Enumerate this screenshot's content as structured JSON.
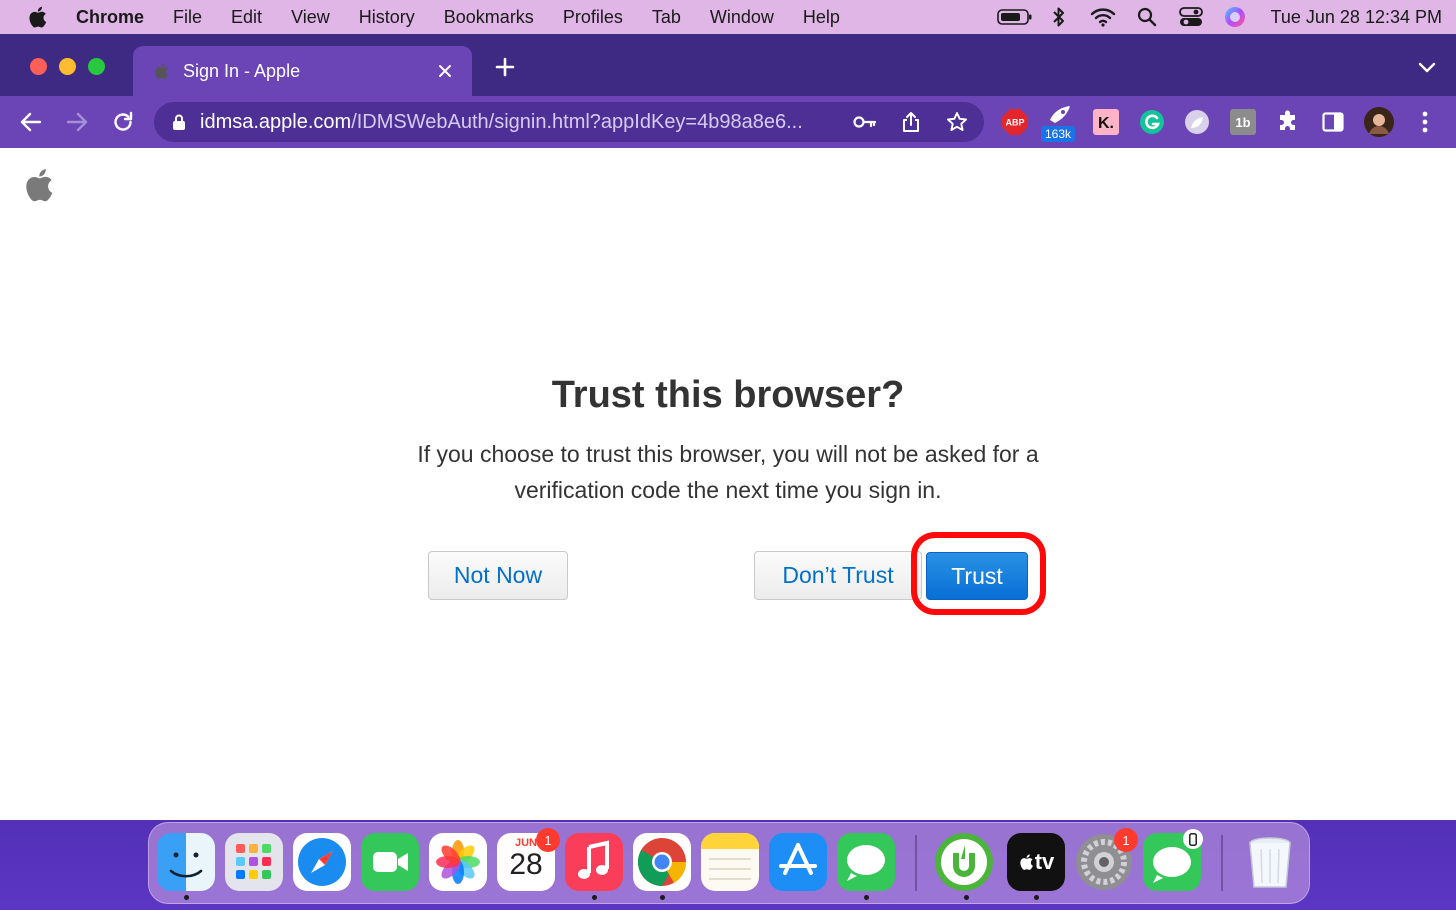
{
  "menubar": {
    "app_name": "Chrome",
    "menus": [
      "File",
      "Edit",
      "View",
      "History",
      "Bookmarks",
      "Profiles",
      "Tab",
      "Window",
      "Help"
    ],
    "clock": "Tue Jun 28  12:34 PM"
  },
  "browser": {
    "tab_title": "Sign In - Apple",
    "url_host": "idmsa.apple.com",
    "url_path": "/IDMSWebAuth/signin.html?appIdKey=4b98a8e6...",
    "extension_badge": "163k",
    "abp_label": "ABP",
    "klarna_label": "K.",
    "ext_1b_label": "1b"
  },
  "page": {
    "title": "Trust this browser?",
    "description": "If you choose to trust this browser, you will not be asked for a verification code the next time you sign in.",
    "not_now_label": "Not Now",
    "dont_trust_label": "Don’t Trust",
    "trust_label": "Trust"
  },
  "dock": {
    "calendar_month": "JUN",
    "calendar_day": "28",
    "calendar_badge": "1",
    "settings_badge": "1",
    "appletv_label": "tv"
  },
  "colors": {
    "accent_blue": "#0870d5",
    "highlight_red": "#ff0a0a",
    "chrome_purple": "#6b44b6"
  }
}
